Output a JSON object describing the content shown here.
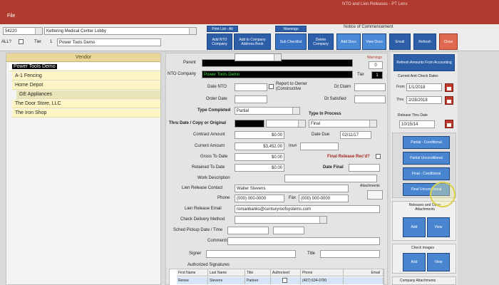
{
  "window": {
    "title": "NTO and Lien Releases - PT Lens"
  },
  "menu": {
    "file": "File"
  },
  "topbar": {
    "job_number": "54220",
    "job_name": "Kettering Medical Center Lobby",
    "all_label": "ALL?",
    "tier_label": "Tier",
    "tier_value": "1",
    "vendor_name": "Power Tools Demo",
    "print_list_label": "Print List - All",
    "add_nto_company": "Add NTO Company",
    "add_company_address_book": "Add to Company Address Book",
    "sub_checklist": "Sub Checklist",
    "delete_company": "Delete Company",
    "warnings": "Warnings",
    "notice_of_commencement": "Notice of Commencement",
    "add_docs": "Add Docs",
    "view_docs": "View Docs",
    "email": "Email",
    "refresh": "Refresh",
    "close": "Close"
  },
  "vendor": {
    "header": "Vendor",
    "items": [
      {
        "label": "Power Tools Demo",
        "level": 0
      },
      {
        "label": "A-1 Fencing",
        "level": 1
      },
      {
        "label": "Home Depot",
        "level": 1
      },
      {
        "label": "GE Appliances",
        "level": 2
      },
      {
        "label": "The Door Store, LLC",
        "level": 1
      },
      {
        "label": "The Iron Shop",
        "level": 1
      }
    ]
  },
  "form": {
    "parent_label": "Parent",
    "nto_company_label": "NTO Company",
    "nto_company_value": "Power Tools Demo",
    "warnings_label": "Warnings",
    "warnings_value": "0",
    "tier_label": "Tier",
    "tier_value": "1",
    "date_nto_label": "Date NTO",
    "report_to_owner": "Report to Owner (Constructive",
    "dt_claim_label": "Dt Claim",
    "order_date_label": "Order Date",
    "dt_satisfied_label": "Dt Satisfied",
    "type_completed_label": "Type Completed",
    "type_completed_value": "Partial",
    "type_in_process_label": "Type In Process",
    "type_in_process_value": "Final",
    "thru_date_label": "Thru Date / Copy or Original",
    "contract_amount_label": "Contract Amount",
    "contract_amount_value": "$0.00",
    "date_due_label": "Date Due",
    "date_due_value": "02/11/17",
    "current_amount_label": "Current Amount",
    "current_amount_value": "$3,452.00",
    "inv_label": "Inv#",
    "gross_to_date_label": "Gross To Date",
    "gross_to_date_value": "$0.00",
    "final_release_label": "Final Release Rec'd?",
    "retained_to_date_label": "Retained To Date",
    "retained_to_date_value": "$0.00",
    "date_final_label": "Date Final",
    "work_description_label": "Work Description",
    "lien_contact_label": "Lien Release Contact",
    "lien_contact_value": "Walter Stevens",
    "attachments_label": "Attachments",
    "phone_label": "Phone",
    "phone_value": "(000) 000-0000",
    "fax_label": "Fax",
    "fax_value": "(000) 000-0000",
    "lien_email_label": "Lien Release Email",
    "lien_email_value": "romanbanks@centuryroofsystems.com",
    "check_delivery_label": "Check Delivery Method",
    "sched_pickup_label": "Sched Pickup Date / Time",
    "comments_label": "Comments",
    "signer_label": "Signer",
    "title_label": "Title",
    "authorized_signatures_label": "Authorized Signatures",
    "sig_columns": [
      "First Name",
      "Last Name",
      "Title",
      "Authorized",
      "Phone",
      "Email"
    ],
    "sig_rows": [
      {
        "first": "Renee",
        "last": "Stevens",
        "title": "Partner",
        "phone": "(407) 634-0700",
        "email": ""
      }
    ]
  },
  "right": {
    "refresh_amounts": "Refresh Amounts From Accounting",
    "current_amt_check_dates": "Current Amt Check Dates",
    "from_label": "From",
    "from_value": "1/1/2018",
    "thru_label": "Thru",
    "thru_value": "2/28/2018",
    "release_thru_date_label": "Release Thru Date",
    "release_thru_date_value": "10/15/14",
    "partial_conditional": "Partial - Conditional",
    "partial_unconditional": "Partial Unconditional",
    "final_conditional": "Final - Conditional",
    "final_unconditional": "Final Unconditional",
    "releases_attachments": "Releases and Other Attachments",
    "add": "Add",
    "view": "View",
    "check_images": "Check Images",
    "company_attachments": "Company Attachments"
  },
  "colors": {
    "accent_red": "#b03a2e",
    "button_blue": "#2d5fa8",
    "vendor_yellow": "#fdf5c4"
  }
}
